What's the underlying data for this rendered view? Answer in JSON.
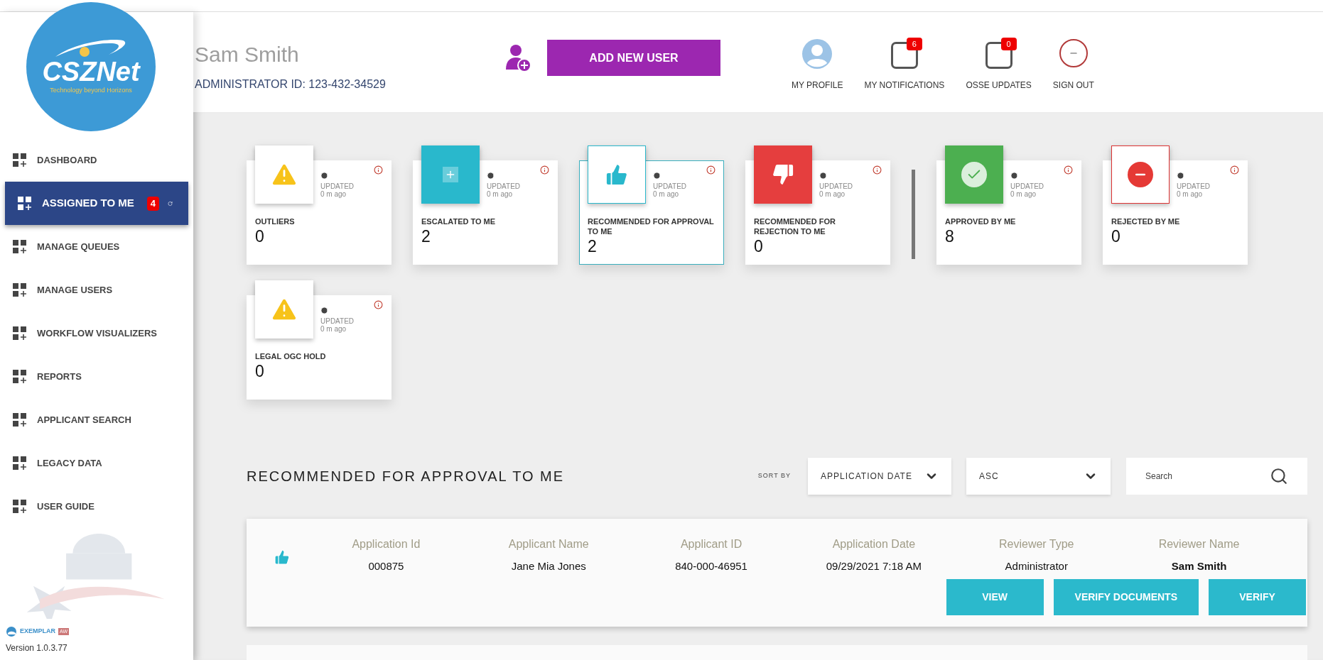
{
  "logo": {
    "name": "CSZNet",
    "tagline": "Technology beyond Horizons"
  },
  "user": {
    "name": "Sam Smith",
    "admin_id": "ADMINISTRATOR ID: 123-432-34529"
  },
  "add_user_button": "ADD NEW USER",
  "header_actions": [
    {
      "kind": "profile",
      "label": "MY PROFILE"
    },
    {
      "kind": "notifications",
      "label": "MY NOTIFICATIONS",
      "badge": "6"
    },
    {
      "kind": "updates",
      "label": "OSSE UPDATES",
      "badge": "0"
    },
    {
      "kind": "signout",
      "label": "SIGN OUT"
    }
  ],
  "sidebar": {
    "items": [
      {
        "label": "DASHBOARD",
        "selected": false
      },
      {
        "label": "ASSIGNED TO ME",
        "selected": true,
        "badge": "4"
      },
      {
        "label": "MANAGE QUEUES",
        "selected": false
      },
      {
        "label": "MANAGE USERS",
        "selected": false
      },
      {
        "label": "WORKFLOW VISUALIZERS",
        "selected": false
      },
      {
        "label": "REPORTS",
        "selected": false
      },
      {
        "label": "APPLICANT SEARCH",
        "selected": false
      },
      {
        "label": "LEGACY DATA",
        "selected": false
      },
      {
        "label": "USER GUIDE",
        "selected": false
      }
    ],
    "brand": "EXEMPLAR",
    "brand_tag": "AW",
    "version": "Version 1.0.3.77"
  },
  "card_rows": [
    {
      "groups": [
        {
          "cards": [
            {
              "kind": "warning",
              "label": "OUTLIERS",
              "value": "0",
              "updated": "UPDATED",
              "ago": "0 m ago",
              "selected": false
            },
            {
              "kind": "escalated",
              "label": "ESCALATED TO ME",
              "value": "2",
              "updated": "UPDATED",
              "ago": "0 m ago",
              "selected": false
            },
            {
              "kind": "approve",
              "label": "RECOMMENDED FOR APPROVAL TO ME",
              "value": "2",
              "updated": "UPDATED",
              "ago": "0 m ago",
              "selected": true
            },
            {
              "kind": "reject",
              "label": "RECOMMENDED FOR REJECTION TO ME",
              "value": "0",
              "updated": "UPDATED",
              "ago": "0 m ago",
              "selected": false
            }
          ]
        },
        {
          "cards": [
            {
              "kind": "approved",
              "label": "APPROVED BY ME",
              "value": "8",
              "updated": "UPDATED",
              "ago": "0 m ago",
              "selected": false
            },
            {
              "kind": "rejected",
              "label": "REJECTED BY ME",
              "value": "0",
              "updated": "UPDATED",
              "ago": "0 m ago",
              "selected": false
            }
          ]
        }
      ]
    },
    {
      "groups": [
        {
          "cards": [
            {
              "kind": "warning",
              "label": "LEGAL OGC HOLD",
              "value": "0",
              "updated": "UPDATED",
              "ago": "0 m ago",
              "selected": false
            }
          ]
        }
      ]
    }
  ],
  "list": {
    "title": "RECOMMENDED FOR APPROVAL TO ME",
    "sort_label": "SORT BY",
    "sort_field": "APPLICATION DATE",
    "sort_order": "ASC",
    "search": {
      "placeholder": "Search"
    },
    "records": [
      {
        "fields": [
          {
            "header": "Application Id",
            "value": "000875"
          },
          {
            "header": "Applicant Name",
            "value": "Jane Mia Jones"
          },
          {
            "header": "Applicant ID",
            "value": "840-000-46951"
          },
          {
            "header": "Application Date",
            "value": "09/29/2021 7:18 AM"
          },
          {
            "header": "Reviewer Type",
            "value": "Administrator"
          },
          {
            "header": "Reviewer Name",
            "value": "Sam Smith"
          }
        ],
        "buttons": [
          "VIEW",
          "VERIFY DOCUMENTS",
          "VERIFY"
        ]
      }
    ]
  }
}
